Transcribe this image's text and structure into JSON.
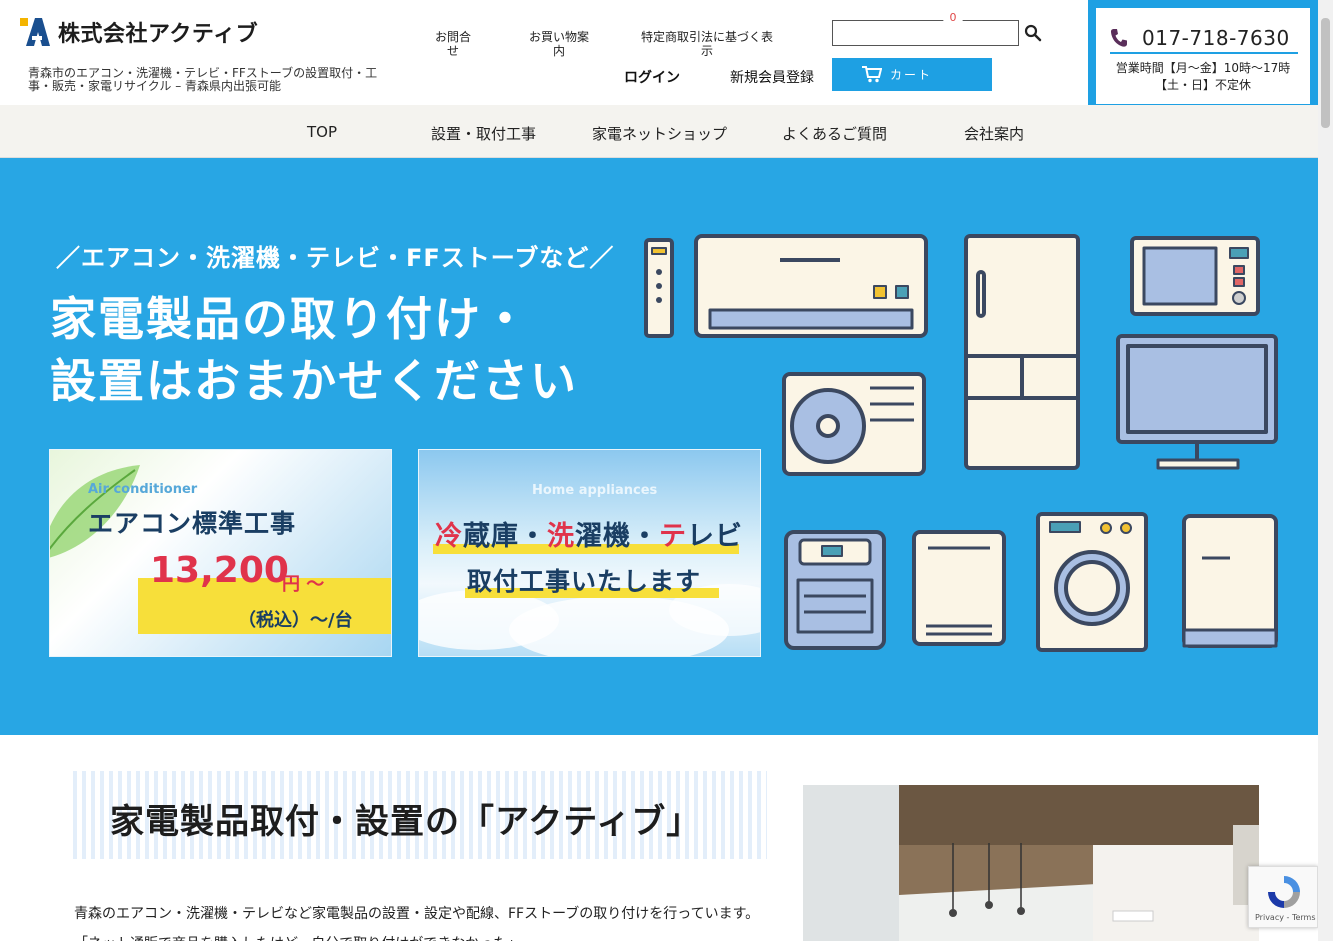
{
  "header": {
    "company_name": "株式会社アクティブ",
    "tagline": "青森市のエアコン・洗濯機・テレビ・FFストーブの設置取付・工事・販売・家電リサイクル – 青森県内出張可能",
    "links": {
      "inquiry": "お問合せ",
      "shopping_guide": "お買い物案内",
      "legal": "特定商取引法に基づく表示"
    },
    "search": {
      "value": "",
      "placeholder": ""
    },
    "login": "ログイン",
    "register": "新規会員登録",
    "cart": {
      "label": "カート",
      "count": "0"
    },
    "contact": {
      "phone": "017-718-7630",
      "hours_line1": "営業時間【月～金】10時～17時",
      "hours_line2": "【土・日】不定休"
    }
  },
  "nav": {
    "items": [
      "TOP",
      "設置・取付工事",
      "家電ネットショップ",
      "よくあるご質問",
      "会社案内"
    ]
  },
  "hero": {
    "subtitle": "／エアコン・洗濯機・テレビ・FFストーブなど／",
    "title_line1": "家電製品の取り付け・",
    "title_line2": "設置はおまかせください",
    "promo1": {
      "en": "Air conditioner",
      "title": "エアコン標準工事",
      "price": "13,200",
      "unit": "円 ～",
      "tax": "（税込）～/台"
    },
    "promo2": {
      "en": "Home appliances",
      "line1_parts": [
        "冷",
        "蔵庫・",
        "洗",
        "濯機・",
        "テ",
        "レビ"
      ],
      "line2": "取付工事いたします"
    }
  },
  "intro": {
    "title": "家電製品取付・設置の「アクティブ」",
    "text1": "青森のエアコン・洗濯機・テレビなど家電製品の設置・設定や配線、FFストーブの取り付けを行っています。",
    "text2": "「ネット通販で商品を購入したけど、自分で取り付けができなかった」"
  },
  "recaptcha": {
    "text": "Privacy - Terms"
  },
  "colors": {
    "accent": "#1ea0e3",
    "hero_bg": "#28a6e4",
    "highlight": "#f7df3a",
    "red": "#e0334b",
    "navy": "#1a3e63"
  }
}
